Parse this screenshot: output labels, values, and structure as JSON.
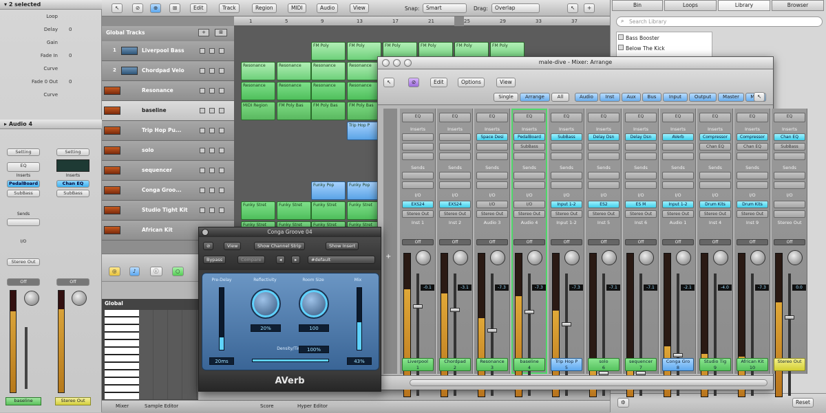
{
  "inspector": {
    "header": "2 selected",
    "rows": [
      {
        "name": "Loop",
        "value": ""
      },
      {
        "name": "Delay",
        "value": "0"
      },
      {
        "name": "Gain",
        "value": ""
      },
      {
        "name": "Fade In",
        "value": "0"
      },
      {
        "name": "Curve",
        "value": ""
      },
      {
        "name": "Fade 0 Out",
        "value": "0"
      },
      {
        "name": "Curve",
        "value": ""
      }
    ],
    "section": "Audio 4",
    "strip_a": {
      "setting": "Setting",
      "eq": "EQ",
      "inserts": "Inserts",
      "plugin": "PedalBoard",
      "plugin2": "SubBass",
      "sends": "Sends",
      "io": "I/O",
      "output": "Stereo Out",
      "off": "Off",
      "label": "baseline"
    },
    "strip_b": {
      "setting": "Setting",
      "inserts": "Inserts",
      "plugin": "Chan EQ",
      "plugin2": "SubBass",
      "off": "Off",
      "label": "Stereo Out"
    }
  },
  "toolbar": {
    "edit": "Edit",
    "track": "Track",
    "region": "Region",
    "midi": "MIDI",
    "audio": "Audio",
    "view": "View",
    "snap_label": "Snap:",
    "snap_value": "Smart",
    "drag_label": "Drag:",
    "drag_value": "Overlap"
  },
  "global_tracks": "Global Tracks",
  "tracks": [
    {
      "num": "1",
      "name": "Liverpool Bass",
      "sel": false,
      "icon": "audio"
    },
    {
      "num": "2",
      "name": "Chordpad Velo",
      "sel": false,
      "icon": "audio"
    },
    {
      "num": "",
      "name": "Resonance",
      "sel": false,
      "icon": "midi"
    },
    {
      "num": "",
      "name": "baseline",
      "sel": true,
      "icon": "midi"
    },
    {
      "num": "",
      "name": "Trip Hop Pu...",
      "sel": false,
      "icon": "midi"
    },
    {
      "num": "",
      "name": "solo",
      "sel": false,
      "icon": "midi"
    },
    {
      "num": "",
      "name": "sequencer",
      "sel": false,
      "icon": "midi"
    },
    {
      "num": "",
      "name": "Conga Groo...",
      "sel": false,
      "icon": "midi"
    },
    {
      "num": "",
      "name": "Studio Tight Kit",
      "sel": false,
      "icon": "midi"
    },
    {
      "num": "",
      "name": "African Kit",
      "sel": false,
      "icon": "midi"
    }
  ],
  "ruler": [
    "1",
    "5",
    "9",
    "13",
    "17",
    "21",
    "25",
    "29",
    "33",
    "37"
  ],
  "regions": [
    {
      "row": 0,
      "start": 112,
      "width": 50,
      "label": "FM Poly",
      "cls": "lgreen"
    },
    {
      "row": 0,
      "start": 164,
      "width": 50,
      "label": "FM Poly",
      "cls": "lgreen"
    },
    {
      "row": 0,
      "start": 216,
      "width": 50,
      "label": "FM Poly",
      "cls": "lgreen"
    },
    {
      "row": 0,
      "start": 268,
      "width": 50,
      "label": "FM Poly",
      "cls": "lgreen"
    },
    {
      "row": 0,
      "start": 320,
      "width": 50,
      "label": "FM Poly",
      "cls": "lgreen"
    },
    {
      "row": 0,
      "start": 372,
      "width": 50,
      "label": "FM Poly",
      "cls": "lgreen"
    },
    {
      "row": 1,
      "start": 10,
      "width": 50,
      "label": "Resonance",
      "cls": "lgreen"
    },
    {
      "row": 1,
      "start": 62,
      "width": 50,
      "label": "Resonance",
      "cls": "lgreen"
    },
    {
      "row": 1,
      "start": 112,
      "width": 50,
      "label": "Resonance",
      "cls": "lgreen"
    },
    {
      "row": 1,
      "start": 164,
      "width": 46,
      "label": "Resonance",
      "cls": "lgreen"
    },
    {
      "row": 2,
      "start": 10,
      "width": 50,
      "label": "Resonance",
      "cls": "green"
    },
    {
      "row": 2,
      "start": 62,
      "width": 50,
      "label": "Resonance",
      "cls": "green"
    },
    {
      "row": 2,
      "start": 112,
      "width": 50,
      "label": "Resonance",
      "cls": "green"
    },
    {
      "row": 2,
      "start": 164,
      "width": 46,
      "label": "Resonance",
      "cls": "green"
    },
    {
      "row": 3,
      "start": 10,
      "width": 50,
      "label": "MIDI Region",
      "cls": "dark"
    },
    {
      "row": 3,
      "start": 62,
      "width": 50,
      "label": "FM Poly Bas",
      "cls": "dark"
    },
    {
      "row": 3,
      "start": 112,
      "width": 50,
      "label": "FM Poly Bas",
      "cls": "dark"
    },
    {
      "row": 3,
      "start": 164,
      "width": 46,
      "label": "FM Poly Bas",
      "cls": "dark"
    },
    {
      "row": 4,
      "start": 164,
      "width": 46,
      "label": "Trip Hop P",
      "cls": "blue"
    },
    {
      "row": 7,
      "start": 112,
      "width": 50,
      "label": "Funky Pop",
      "cls": "blue"
    },
    {
      "row": 7,
      "start": 164,
      "width": 46,
      "label": "Funky Pop",
      "cls": "blue"
    },
    {
      "row": 8,
      "start": 10,
      "width": 50,
      "label": "Funky Stret",
      "cls": "green"
    },
    {
      "row": 8,
      "start": 62,
      "width": 50,
      "label": "Funky Stret",
      "cls": "green"
    },
    {
      "row": 8,
      "start": 112,
      "width": 50,
      "label": "Funky Stret",
      "cls": "green"
    },
    {
      "row": 8,
      "start": 164,
      "width": 46,
      "label": "Funky Stret",
      "cls": "green"
    },
    {
      "row": 9,
      "start": 10,
      "width": 50,
      "label": "Funky Stret",
      "cls": "green"
    },
    {
      "row": 9,
      "start": 62,
      "width": 50,
      "label": "Funky Stret",
      "cls": "green"
    },
    {
      "row": 9,
      "start": 112,
      "width": 50,
      "label": "Funky Stret",
      "cls": "green"
    },
    {
      "row": 9,
      "start": 164,
      "width": 46,
      "label": "Funky Stret",
      "cls": "green"
    }
  ],
  "lower": {
    "global": "Global",
    "mixer": "Mixer",
    "sample_editor": "Sample Editor",
    "score": "Score",
    "hyper_editor": "Hyper Editor"
  },
  "library": {
    "tabs": [
      "Bin",
      "Loops",
      "Library",
      "Browser"
    ],
    "search_placeholder": "Search Library",
    "items": [
      "Bass Booster",
      "Below The Kick"
    ],
    "bottom_btn": "Reset"
  },
  "mixer": {
    "title": "male-dive - Mixer: Arrange",
    "edit": "Edit",
    "options": "Options",
    "view": "View",
    "views": [
      "Single",
      "Arrange",
      "All"
    ],
    "filters": [
      "Audio",
      "Inst",
      "Aux",
      "Bus",
      "Input",
      "Output",
      "Master",
      "MIDI"
    ],
    "strips": [
      {
        "name": "Liverpool",
        "num": "1",
        "ins": "",
        "io": "EXS24",
        "out": "Stereo Out",
        "grp": "Inst 1",
        "db": "-0.1",
        "level": 0.75,
        "color": "green"
      },
      {
        "name": "Chordpad",
        "num": "2",
        "ins": "",
        "io": "EXS24",
        "out": "Stereo Out",
        "grp": "Inst 2",
        "db": "-3.1",
        "level": 0.72,
        "color": "green"
      },
      {
        "name": "Resonance",
        "num": "3",
        "ins": "Space Desi",
        "io": "I/O",
        "out": "Stereo Out",
        "grp": "Audio 3",
        "db": "-7.3",
        "level": 0.55,
        "color": "green"
      },
      {
        "name": "baseline",
        "num": "4",
        "ins": "PedalBoard",
        "ins2": "SubBass",
        "io": "I/O",
        "out": "Stereo Out",
        "grp": "Audio 4",
        "db": "-7.3",
        "level": 0.7,
        "color": "green",
        "sel": true
      },
      {
        "name": "Trip Hop P",
        "num": "5",
        "ins": "SubBass",
        "io": "Input 1-2",
        "out": "Stereo Out",
        "grp": "Input 1-2",
        "db": "-7.3",
        "level": 0.6,
        "color": "blue"
      },
      {
        "name": "solo",
        "num": "6",
        "ins": "Delay Dsn",
        "io": "ES2",
        "out": "Stereo Out",
        "grp": "Inst 5",
        "db": "-7.1",
        "level": 0.2,
        "color": "green"
      },
      {
        "name": "sequencer",
        "num": "7",
        "ins": "Delay Dsn",
        "io": "ES M",
        "out": "Stereo Out",
        "grp": "Inst 6",
        "db": "-7.1",
        "level": 0.2,
        "color": "green"
      },
      {
        "name": "Conga Gro",
        "num": "8",
        "ins": "AVerb",
        "io": "Input 1-2",
        "out": "Stereo Out",
        "grp": "Audio 1",
        "db": "-2.1",
        "level": 0.35,
        "color": "blue"
      },
      {
        "name": "Studio Tig",
        "num": "9",
        "ins": "Compressor",
        "ins2": "Chan EQ",
        "io": "Drum Kits",
        "out": "Stereo Out",
        "grp": "Inst 4",
        "db": "-4.0",
        "level": 0.3,
        "color": "green"
      },
      {
        "name": "African Kit",
        "num": "10",
        "ins": "Compressor",
        "ins2": "Chan EQ",
        "io": "Drum Kits",
        "out": "Stereo Out",
        "grp": "Inst 9",
        "db": "-7.3",
        "level": 0.28,
        "color": "green"
      },
      {
        "name": "Stereo Out",
        "num": "",
        "ins": "Chan EQ",
        "ins2": "SubBass",
        "io": "",
        "out": "",
        "grp": "Stereo Out",
        "db": "0.0",
        "level": 0.66,
        "color": "yellow"
      }
    ],
    "labels": {
      "eq": "EQ",
      "inserts": "Inserts",
      "sends": "Sends",
      "io": "I/O",
      "off": "Off"
    }
  },
  "plugin": {
    "title": "Conga Groove 04",
    "view": "View",
    "show_strip": "Show Channel Strip",
    "show_insert": "Show Insert",
    "bypass": "Bypass",
    "compare": "Compare",
    "preset": "#default",
    "predelay_label": "Pre-Delay",
    "reflectivity_label": "Reflectivity",
    "roomsize_label": "Room Size",
    "mix_label": "Mix",
    "predelay": "20ms",
    "reflectivity": "20%",
    "roomsize": "100",
    "mix": "43%",
    "density_label": "Density/Time",
    "density": "100%",
    "name": "AVerb"
  }
}
